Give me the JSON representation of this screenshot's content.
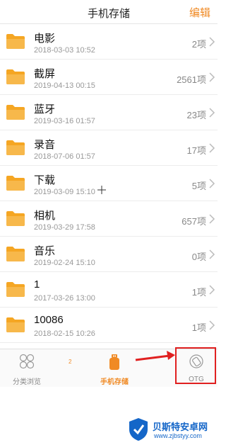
{
  "header": {
    "title": "手机存储",
    "edit_label": "编辑"
  },
  "folders": [
    {
      "name": "电影",
      "date": "2018-03-03 10:52",
      "count": "2项"
    },
    {
      "name": "截屏",
      "date": "2019-04-13 00:15",
      "count": "2561项"
    },
    {
      "name": "蓝牙",
      "date": "2019-03-16 01:57",
      "count": "23项"
    },
    {
      "name": "录音",
      "date": "2018-07-06 01:57",
      "count": "17项"
    },
    {
      "name": "下载",
      "date": "2019-03-09 15:10",
      "count": "5项"
    },
    {
      "name": "相机",
      "date": "2019-03-29 17:58",
      "count": "657项"
    },
    {
      "name": "音乐",
      "date": "2019-02-24 15:10",
      "count": "0项"
    },
    {
      "name": "1",
      "date": "2017-03-26 13:00",
      "count": "1项"
    },
    {
      "name": "10086",
      "date": "2018-02-15 10:26",
      "count": "1项"
    }
  ],
  "tabbar": {
    "browse_label": "分类浏览",
    "storage_label": "手机存储",
    "otg_label": "OTG",
    "active": "storage",
    "badge": "2"
  },
  "watermark": {
    "title": "贝斯特安卓网",
    "url": "www.zjbstyy.com"
  },
  "colors": {
    "accent": "#f08a24",
    "folder": "#f5a623",
    "highlight": "#e02020",
    "watermark": "#1466c8"
  }
}
